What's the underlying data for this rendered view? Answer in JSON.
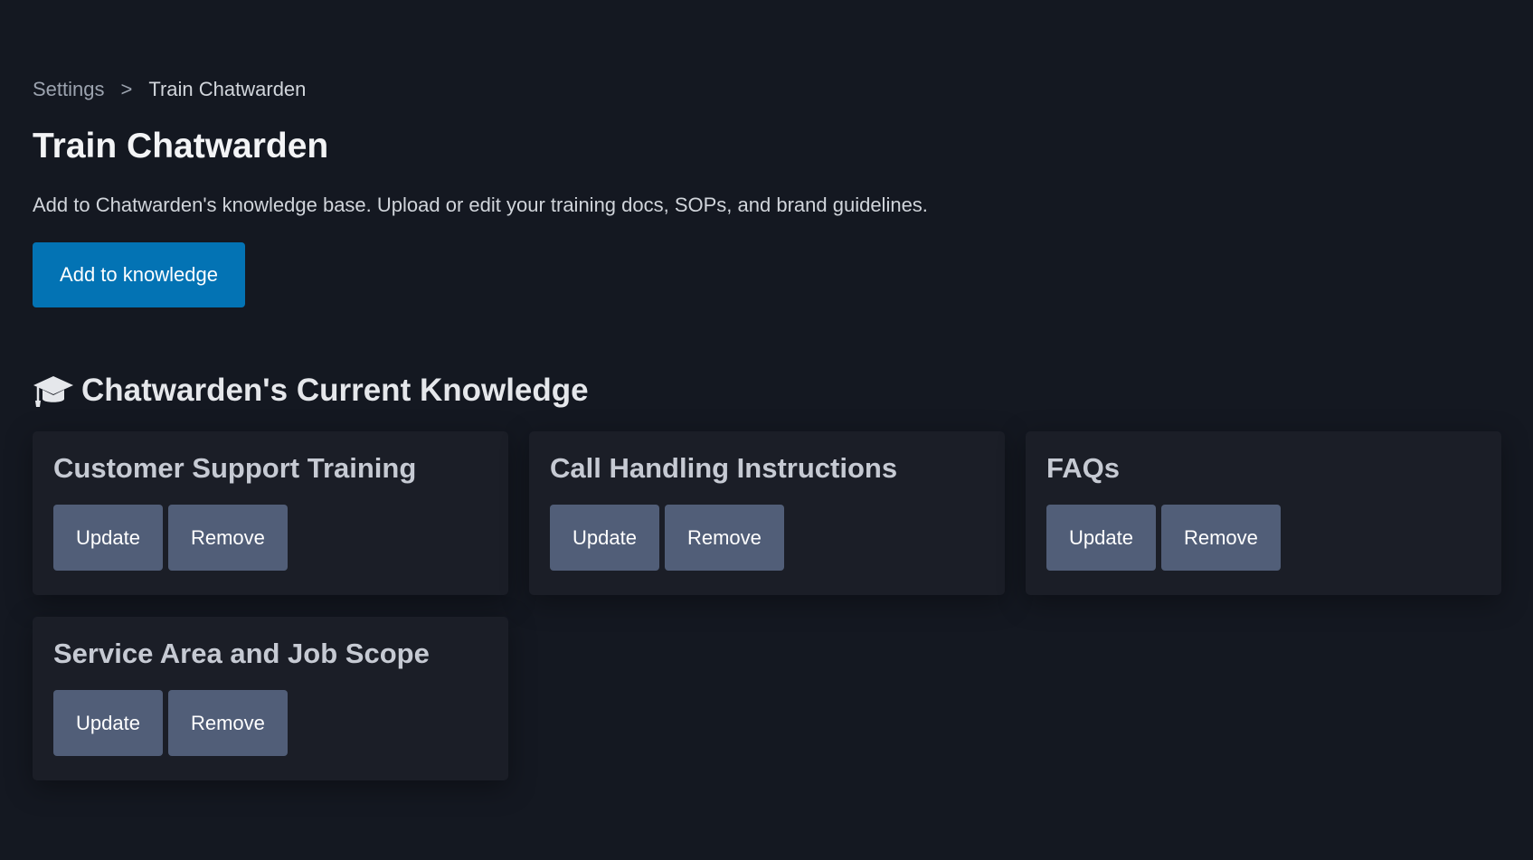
{
  "breadcrumb": {
    "parent": "Settings",
    "separator": ">",
    "current": "Train Chatwarden"
  },
  "page": {
    "title": "Train Chatwarden",
    "description": "Add to Chatwarden's knowledge base. Upload or edit your training docs, SOPs, and brand guidelines.",
    "add_button": "Add to knowledge"
  },
  "section": {
    "icon": "graduation-cap-icon",
    "title": "Chatwarden's Current Knowledge"
  },
  "knowledge": [
    {
      "title": "Customer Support Training",
      "update": "Update",
      "remove": "Remove"
    },
    {
      "title": "Call Handling Instructions",
      "update": "Update",
      "remove": "Remove"
    },
    {
      "title": "FAQs",
      "update": "Update",
      "remove": "Remove"
    },
    {
      "title": "Service Area and Job Scope",
      "update": "Update",
      "remove": "Remove"
    }
  ],
  "colors": {
    "background": "#141821",
    "card": "#1b1e27",
    "primary": "#0373b4",
    "secondary_button": "#515e78"
  }
}
